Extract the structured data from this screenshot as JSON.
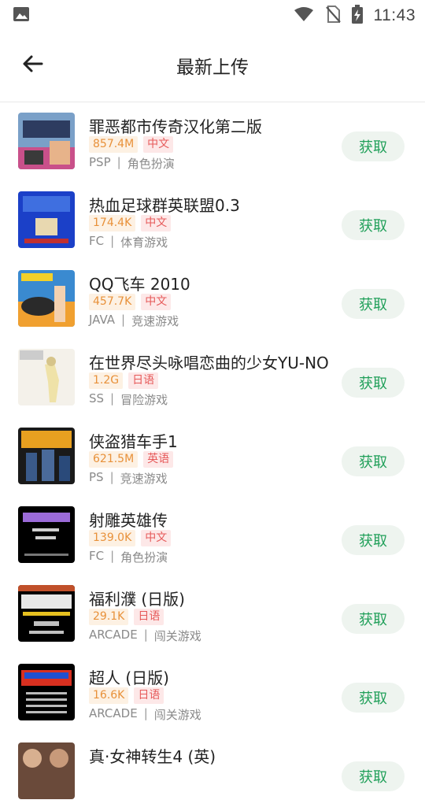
{
  "status": {
    "time": "11:43",
    "icons": [
      "image-icon",
      "wifi-icon",
      "no-sim-icon",
      "battery-charging-icon"
    ]
  },
  "header": {
    "title": "最新上传",
    "back_icon": "arrow-left-icon"
  },
  "colors": {
    "accent_green": "#21a05a",
    "button_bg": "#eef4ef",
    "size_tag": "#e8913a",
    "lang_tag": "#e65a5a"
  },
  "items": [
    {
      "name": "罪恶都市传奇汉化第二版",
      "size": "857.4M",
      "lang": "中文",
      "platform": "PSP",
      "category": "角色扮演",
      "button": "获取"
    },
    {
      "name": "热血足球群英联盟0.3",
      "size": "174.4K",
      "lang": "中文",
      "platform": "FC",
      "category": "体育游戏",
      "button": "获取"
    },
    {
      "name": "QQ飞车 2010",
      "size": "457.7K",
      "lang": "中文",
      "platform": "JAVA",
      "category": "竞速游戏",
      "button": "获取"
    },
    {
      "name": "在世界尽头咏唱恋曲的少女YU-NO",
      "size": "1.2G",
      "lang": "日语",
      "platform": "SS",
      "category": "冒险游戏",
      "button": "获取"
    },
    {
      "name": "侠盗猎车手1",
      "size": "621.5M",
      "lang": "英语",
      "platform": "PS",
      "category": "竞速游戏",
      "button": "获取"
    },
    {
      "name": "射雕英雄传",
      "size": "139.0K",
      "lang": "中文",
      "platform": "FC",
      "category": "角色扮演",
      "button": "获取"
    },
    {
      "name": "福利濮 (日版)",
      "size": "29.1K",
      "lang": "日语",
      "platform": "ARCADE",
      "category": "闯关游戏",
      "button": "获取"
    },
    {
      "name": "超人 (日版)",
      "size": "16.6K",
      "lang": "日语",
      "platform": "ARCADE",
      "category": "闯关游戏",
      "button": "获取"
    },
    {
      "name": "真·女神转生4 (英)",
      "size": "",
      "lang": "",
      "platform": "",
      "category": "",
      "button": "获取"
    }
  ]
}
